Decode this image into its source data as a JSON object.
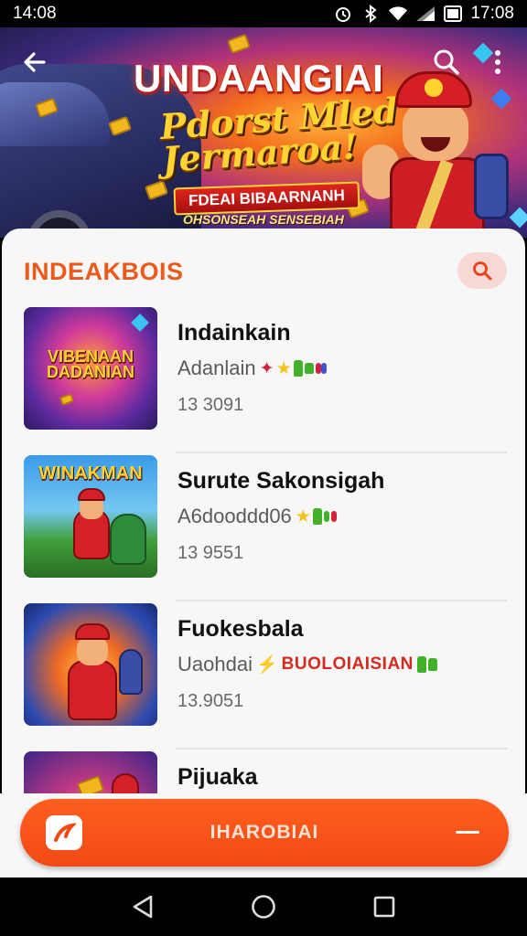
{
  "status_bar": {
    "time_left": "14:08",
    "time_right": "17:08",
    "icons": [
      "alarm-icon",
      "bluetooth-icon",
      "wifi-icon",
      "signal-icon",
      "battery-icon"
    ]
  },
  "banner": {
    "title": "UNDAANGIAI",
    "subtitle_line1": "Pdorst Mled",
    "subtitle_line2": "Jermaroa!",
    "ribbon": "FDEAI BIBAARNANH",
    "tagline": "OHSONSEAH SENSEBIAH"
  },
  "section": {
    "title": "INDEAKBOIS"
  },
  "games": [
    {
      "name": "Indainkain",
      "meta": "Adanlain",
      "tag": "",
      "count": "13 3091",
      "thumb_text": "VIBENAAN DADANIAN"
    },
    {
      "name": "Surute Sakonsigah",
      "meta": "A6dooddd06",
      "tag": "",
      "count": "13 9551",
      "thumb_text": "WINAKMAN"
    },
    {
      "name": "Fuokesbala",
      "meta": "Uaohdai",
      "tag": "BUOLOIAISIAN",
      "count": "13.9051",
      "thumb_text": ""
    },
    {
      "name": "Pijuaka",
      "meta": "",
      "tag": "",
      "count": "",
      "thumb_text": ""
    }
  ],
  "cta": {
    "label": "IHAROBIAI"
  },
  "colors": {
    "accent": "#f24914",
    "section_title": "#ea5a1c",
    "sheet_bg": "#f7f7f7"
  }
}
